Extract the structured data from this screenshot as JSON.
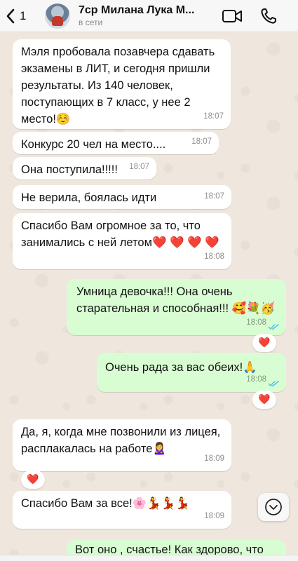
{
  "header": {
    "back_count": "1",
    "title": "7ср Милана Лука М...",
    "status": "в сети"
  },
  "messages": [
    {
      "text": "Мэля пробовала позавчера сдавать экзамены в ЛИТ, и сегодня пришли результаты. Из 140 человек, поступающих в 7 класс, у нее 2 место!☺️",
      "time": "18:07"
    },
    {
      "text": "Конкурс 20 чел на место....",
      "time": "18:07"
    },
    {
      "text": "Она поступила!!!!!",
      "time": "18:07"
    },
    {
      "text": "Не верила, боялась идти",
      "time": "18:07"
    },
    {
      "text": "Спасибо Вам огромное за то, что занимались с ней летом❤️ ❤️ ❤️ ❤️",
      "time": "18:08"
    },
    {
      "text": "Умница девочка!!! Она очень старательная и способная!!! 🥰💐🥳",
      "time": "18:08",
      "reaction": "❤️"
    },
    {
      "text": "Очень рада за вас обеих!🙏",
      "time": "18:08",
      "reaction": "❤️"
    },
    {
      "text": "Да, я, когда мне позвонили из лицея, расплакалась на работе🙎‍♀️",
      "time": "18:09",
      "reaction": "❤️"
    },
    {
      "text": "Спасибо Вам за все!🌸💃💃💃",
      "time": "18:09"
    },
    {
      "text": "Вот оно , счастье! Как здорово, что"
    }
  ],
  "colors": {
    "incoming_bubble": "#ffffff",
    "outgoing_bubble": "#d9fdd3",
    "read_ticks": "#53bdeb",
    "heart": "#e0162b"
  },
  "icons": [
    "chevron-left-icon",
    "video-call-icon",
    "phone-icon",
    "double-check-icon",
    "scroll-down-icon"
  ]
}
